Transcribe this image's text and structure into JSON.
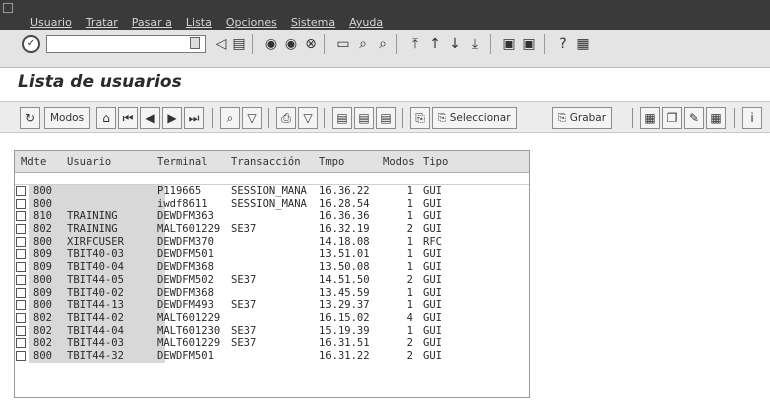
{
  "menu": [
    "Usuario",
    "Tratar",
    "Pasar a",
    "Lista",
    "Opciones",
    "Sistema",
    "Ayuda"
  ],
  "command_field": {
    "value": ""
  },
  "title": "Lista de usuarios",
  "appbar": {
    "modos_label": "Modos",
    "seleccionar_label": "Seleccionar",
    "grabar_label": "Grabar"
  },
  "list": {
    "headers": {
      "mdte": "Mdte",
      "usuario": "Usuario",
      "terminal": "Terminal",
      "transaccion": "Transacción",
      "tmpo": "Tmpo",
      "modos": "Modos",
      "tipo": "Tipo"
    },
    "rows": [
      {
        "mdte": "800",
        "usuario": "",
        "terminal": "P119665",
        "transaccion": "SESSION_MANA",
        "tmpo": "16.36.22",
        "modos": "1",
        "tipo": "GUI"
      },
      {
        "mdte": "800",
        "usuario": "",
        "terminal": "iwdf8611",
        "transaccion": "SESSION_MANA",
        "tmpo": "16.28.54",
        "modos": "1",
        "tipo": "GUI"
      },
      {
        "mdte": "810",
        "usuario": "TRAINING",
        "terminal": "DEWDFM363",
        "transaccion": "",
        "tmpo": "16.36.36",
        "modos": "1",
        "tipo": "GUI"
      },
      {
        "mdte": "802",
        "usuario": "TRAINING",
        "terminal": "MALT601229",
        "transaccion": "SE37",
        "tmpo": "16.32.19",
        "modos": "2",
        "tipo": "GUI"
      },
      {
        "mdte": "800",
        "usuario": "XIRFCUSER",
        "terminal": "DEWDFM370",
        "transaccion": "",
        "tmpo": "14.18.08",
        "modos": "1",
        "tipo": "RFC"
      },
      {
        "mdte": "809",
        "usuario": "TBIT40-03",
        "terminal": "DEWDFM501",
        "transaccion": "",
        "tmpo": "13.51.01",
        "modos": "1",
        "tipo": "GUI"
      },
      {
        "mdte": "809",
        "usuario": "TBIT40-04",
        "terminal": "DEWDFM368",
        "transaccion": "",
        "tmpo": "13.50.08",
        "modos": "1",
        "tipo": "GUI"
      },
      {
        "mdte": "800",
        "usuario": "TBIT44-05",
        "terminal": "DEWDFM502",
        "transaccion": "SE37",
        "tmpo": "14.51.50",
        "modos": "2",
        "tipo": "GUI"
      },
      {
        "mdte": "809",
        "usuario": "TBIT40-02",
        "terminal": "DEWDFM368",
        "transaccion": "",
        "tmpo": "13.45.59",
        "modos": "1",
        "tipo": "GUI"
      },
      {
        "mdte": "800",
        "usuario": "TBIT44-13",
        "terminal": "DEWDFM493",
        "transaccion": "SE37",
        "tmpo": "13.29.37",
        "modos": "1",
        "tipo": "GUI"
      },
      {
        "mdte": "802",
        "usuario": "TBIT44-02",
        "terminal": "MALT601229",
        "transaccion": "",
        "tmpo": "16.15.02",
        "modos": "4",
        "tipo": "GUI"
      },
      {
        "mdte": "802",
        "usuario": "TBIT44-04",
        "terminal": "MALT601230",
        "transaccion": "SE37",
        "tmpo": "15.19.39",
        "modos": "1",
        "tipo": "GUI"
      },
      {
        "mdte": "802",
        "usuario": "TBIT44-03",
        "terminal": "MALT601229",
        "transaccion": "SE37",
        "tmpo": "16.31.51",
        "modos": "2",
        "tipo": "GUI"
      },
      {
        "mdte": "800",
        "usuario": "TBIT44-32",
        "terminal": "DEWDFM501",
        "transaccion": "",
        "tmpo": "16.31.22",
        "modos": "2",
        "tipo": "GUI"
      }
    ]
  }
}
